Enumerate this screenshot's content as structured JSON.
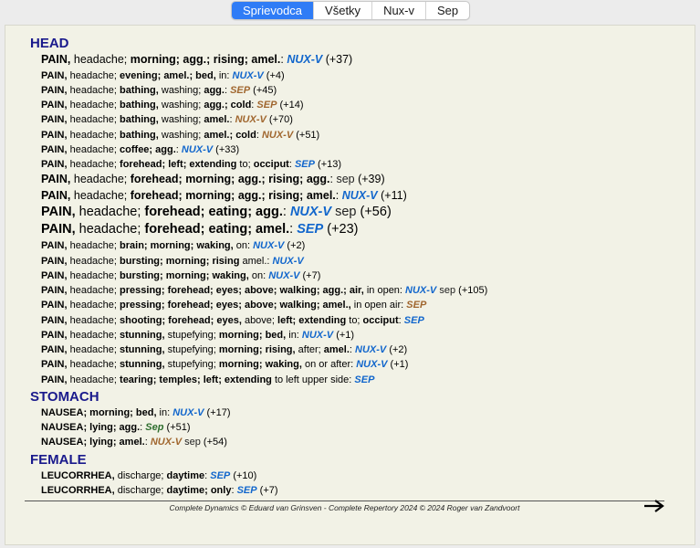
{
  "tabs": [
    {
      "label": "Sprievodca",
      "active": true
    },
    {
      "label": "Všetky",
      "active": false
    },
    {
      "label": "Nux-v",
      "active": false
    },
    {
      "label": "Sep",
      "active": false
    }
  ],
  "chapters": [
    {
      "title": "HEAD",
      "rubrics": [
        {
          "size": 2,
          "parts": [
            [
              "b",
              "PAIN,"
            ],
            [
              "n",
              " headache; "
            ],
            [
              "b",
              "morning; agg.; rising; amel."
            ],
            [
              "n",
              ": "
            ],
            [
              "blue",
              "NUX-V"
            ],
            [
              "n",
              " (+37)"
            ]
          ]
        },
        {
          "size": 1,
          "parts": [
            [
              "b",
              "PAIN,"
            ],
            [
              "n",
              " headache; "
            ],
            [
              "b",
              "evening; amel.; bed,"
            ],
            [
              "n",
              " in: "
            ],
            [
              "blue",
              "NUX-V"
            ],
            [
              "n",
              " (+4)"
            ]
          ]
        },
        {
          "size": 1,
          "parts": [
            [
              "b",
              "PAIN,"
            ],
            [
              "n",
              " headache; "
            ],
            [
              "b",
              "bathing,"
            ],
            [
              "n",
              " washing; "
            ],
            [
              "b",
              "agg."
            ],
            [
              "n",
              ": "
            ],
            [
              "brown",
              "SEP"
            ],
            [
              "n",
              " (+45)"
            ]
          ]
        },
        {
          "size": 1,
          "parts": [
            [
              "b",
              "PAIN,"
            ],
            [
              "n",
              " headache; "
            ],
            [
              "b",
              "bathing,"
            ],
            [
              "n",
              " washing; "
            ],
            [
              "b",
              "agg.; cold"
            ],
            [
              "n",
              ": "
            ],
            [
              "brown",
              "SEP"
            ],
            [
              "n",
              " (+14)"
            ]
          ]
        },
        {
          "size": 1,
          "parts": [
            [
              "b",
              "PAIN,"
            ],
            [
              "n",
              " headache; "
            ],
            [
              "b",
              "bathing,"
            ],
            [
              "n",
              " washing; "
            ],
            [
              "b",
              "amel."
            ],
            [
              "n",
              ": "
            ],
            [
              "brown",
              "NUX-V"
            ],
            [
              "n",
              " (+70)"
            ]
          ]
        },
        {
          "size": 1,
          "parts": [
            [
              "b",
              "PAIN,"
            ],
            [
              "n",
              " headache; "
            ],
            [
              "b",
              "bathing,"
            ],
            [
              "n",
              " washing; "
            ],
            [
              "b",
              "amel.; cold"
            ],
            [
              "n",
              ": "
            ],
            [
              "brown",
              "NUX-V"
            ],
            [
              "n",
              " (+51)"
            ]
          ]
        },
        {
          "size": 1,
          "parts": [
            [
              "b",
              "PAIN,"
            ],
            [
              "n",
              " headache; "
            ],
            [
              "b",
              "coffee; agg."
            ],
            [
              "n",
              ": "
            ],
            [
              "blue",
              "NUX-V"
            ],
            [
              "n",
              " (+33)"
            ]
          ]
        },
        {
          "size": 1,
          "parts": [
            [
              "b",
              "PAIN,"
            ],
            [
              "n",
              " headache; "
            ],
            [
              "b",
              "forehead; left; extending"
            ],
            [
              "n",
              " to; "
            ],
            [
              "b",
              "occiput"
            ],
            [
              "n",
              ": "
            ],
            [
              "blue",
              "SEP"
            ],
            [
              "n",
              " (+13)"
            ]
          ]
        },
        {
          "size": 2,
          "parts": [
            [
              "b",
              "PAIN,"
            ],
            [
              "n",
              " headache; "
            ],
            [
              "b",
              "forehead; morning; agg.; rising; agg."
            ],
            [
              "n",
              ": "
            ],
            [
              "plain",
              "sep"
            ],
            [
              "n",
              " (+39)"
            ]
          ]
        },
        {
          "size": 2,
          "parts": [
            [
              "b",
              "PAIN,"
            ],
            [
              "n",
              " headache; "
            ],
            [
              "b",
              "forehead; morning; agg.; rising; amel."
            ],
            [
              "n",
              ": "
            ],
            [
              "blue",
              "NUX-V"
            ],
            [
              "n",
              " (+11)"
            ]
          ]
        },
        {
          "size": 3,
          "parts": [
            [
              "b",
              "PAIN,"
            ],
            [
              "n",
              " headache; "
            ],
            [
              "b",
              "forehead; eating; agg."
            ],
            [
              "n",
              ": "
            ],
            [
              "blue",
              "NUX-V"
            ],
            [
              "n",
              " "
            ],
            [
              "plain",
              "sep"
            ],
            [
              "n",
              " (+56)"
            ]
          ]
        },
        {
          "size": 3,
          "parts": [
            [
              "b",
              "PAIN,"
            ],
            [
              "n",
              " headache; "
            ],
            [
              "b",
              "forehead; eating; amel."
            ],
            [
              "n",
              ": "
            ],
            [
              "blue",
              "SEP"
            ],
            [
              "n",
              " (+23)"
            ]
          ]
        },
        {
          "size": 1,
          "parts": [
            [
              "b",
              "PAIN,"
            ],
            [
              "n",
              " headache; "
            ],
            [
              "b",
              "brain; morning; waking,"
            ],
            [
              "n",
              " on: "
            ],
            [
              "blue",
              "NUX-V"
            ],
            [
              "n",
              " (+2)"
            ]
          ]
        },
        {
          "size": 1,
          "parts": [
            [
              "b",
              "PAIN,"
            ],
            [
              "n",
              " headache; "
            ],
            [
              "b",
              "bursting; morning; rising"
            ],
            [
              "n",
              " amel.: "
            ],
            [
              "blue",
              "NUX-V"
            ]
          ]
        },
        {
          "size": 1,
          "parts": [
            [
              "b",
              "PAIN,"
            ],
            [
              "n",
              " headache; "
            ],
            [
              "b",
              "bursting; morning; waking,"
            ],
            [
              "n",
              " on: "
            ],
            [
              "blue",
              "NUX-V"
            ],
            [
              "n",
              " (+7)"
            ]
          ]
        },
        {
          "size": 1,
          "parts": [
            [
              "b",
              "PAIN,"
            ],
            [
              "n",
              " headache; "
            ],
            [
              "b",
              "pressing; forehead; eyes; above; walking; agg.; air,"
            ],
            [
              "n",
              " in open: "
            ],
            [
              "blue",
              "NUX-V"
            ],
            [
              "n",
              " "
            ],
            [
              "plain",
              "sep"
            ],
            [
              "n",
              " (+105)"
            ]
          ]
        },
        {
          "size": 1,
          "parts": [
            [
              "b",
              "PAIN,"
            ],
            [
              "n",
              " headache; "
            ],
            [
              "b",
              "pressing; forehead; eyes; above; walking; amel.,"
            ],
            [
              "n",
              " in open air: "
            ],
            [
              "brown",
              "SEP"
            ]
          ]
        },
        {
          "size": 1,
          "parts": [
            [
              "b",
              "PAIN,"
            ],
            [
              "n",
              " headache; "
            ],
            [
              "b",
              "shooting; forehead; eyes,"
            ],
            [
              "n",
              " above; "
            ],
            [
              "b",
              "left; extending"
            ],
            [
              "n",
              " to; "
            ],
            [
              "b",
              "occiput"
            ],
            [
              "n",
              ": "
            ],
            [
              "blue",
              "SEP"
            ]
          ]
        },
        {
          "size": 1,
          "parts": [
            [
              "b",
              "PAIN,"
            ],
            [
              "n",
              " headache; "
            ],
            [
              "b",
              "stunning,"
            ],
            [
              "n",
              " stupefying; "
            ],
            [
              "b",
              "morning; bed,"
            ],
            [
              "n",
              " in: "
            ],
            [
              "blue",
              "NUX-V"
            ],
            [
              "n",
              " (+1)"
            ]
          ]
        },
        {
          "size": 1,
          "parts": [
            [
              "b",
              "PAIN,"
            ],
            [
              "n",
              " headache; "
            ],
            [
              "b",
              "stunning,"
            ],
            [
              "n",
              " stupefying; "
            ],
            [
              "b",
              "morning; rising,"
            ],
            [
              "n",
              " after; "
            ],
            [
              "b",
              "amel."
            ],
            [
              "n",
              ": "
            ],
            [
              "blue",
              "NUX-V"
            ],
            [
              "n",
              " (+2)"
            ]
          ]
        },
        {
          "size": 1,
          "parts": [
            [
              "b",
              "PAIN,"
            ],
            [
              "n",
              " headache; "
            ],
            [
              "b",
              "stunning,"
            ],
            [
              "n",
              " stupefying; "
            ],
            [
              "b",
              "morning; waking,"
            ],
            [
              "n",
              " on or after: "
            ],
            [
              "blue",
              "NUX-V"
            ],
            [
              "n",
              " (+1)"
            ]
          ]
        },
        {
          "size": 1,
          "parts": [
            [
              "b",
              "PAIN,"
            ],
            [
              "n",
              " headache; "
            ],
            [
              "b",
              "tearing; temples; left; extending"
            ],
            [
              "n",
              " to left upper side: "
            ],
            [
              "blue",
              "SEP"
            ]
          ]
        }
      ]
    },
    {
      "title": "STOMACH",
      "rubrics": [
        {
          "size": 1,
          "parts": [
            [
              "b",
              "NAUSEA; morning; bed,"
            ],
            [
              "n",
              " in: "
            ],
            [
              "blue",
              "NUX-V"
            ],
            [
              "n",
              " (+17)"
            ]
          ]
        },
        {
          "size": 1,
          "parts": [
            [
              "b",
              "NAUSEA; lying; agg."
            ],
            [
              "n",
              ": "
            ],
            [
              "green",
              "Sep"
            ],
            [
              "n",
              " (+51)"
            ]
          ]
        },
        {
          "size": 1,
          "parts": [
            [
              "b",
              "NAUSEA; lying; amel."
            ],
            [
              "n",
              ": "
            ],
            [
              "brown",
              "NUX-V"
            ],
            [
              "n",
              " "
            ],
            [
              "plain",
              "sep"
            ],
            [
              "n",
              " (+54)"
            ]
          ]
        }
      ]
    },
    {
      "title": "FEMALE",
      "rubrics": [
        {
          "size": 1,
          "parts": [
            [
              "b",
              "LEUCORRHEA,"
            ],
            [
              "n",
              " discharge; "
            ],
            [
              "b",
              "daytime"
            ],
            [
              "n",
              ": "
            ],
            [
              "blue",
              "SEP"
            ],
            [
              "n",
              " (+10)"
            ]
          ]
        },
        {
          "size": 1,
          "parts": [
            [
              "b",
              "LEUCORRHEA,"
            ],
            [
              "n",
              " discharge; "
            ],
            [
              "b",
              "daytime; only"
            ],
            [
              "n",
              ": "
            ],
            [
              "blue",
              "SEP"
            ],
            [
              "n",
              " (+7)"
            ]
          ]
        }
      ]
    }
  ],
  "footer": {
    "text": "Complete Dynamics © Eduard van Grinsven  -  Complete Repertory 2024 © 2024 Roger van Zandvoort",
    "next_icon": "arrow-right-icon"
  },
  "colors": {
    "remedy_blue": "#1166cc",
    "remedy_brown": "#a0662e",
    "remedy_green": "#2e6e2e",
    "chapter": "#1a1a8c",
    "tab_active": "#2f7cf6"
  }
}
